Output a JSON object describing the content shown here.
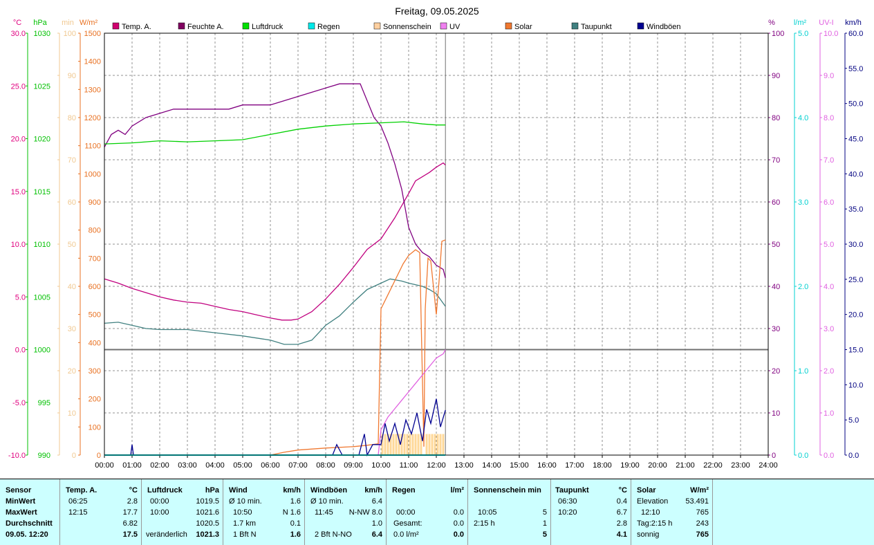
{
  "chart_data": {
    "type": "line",
    "title": "Freitag, 09.05.2025",
    "x_ticks": [
      "00:00",
      "01:00",
      "02:00",
      "03:00",
      "04:00",
      "05:00",
      "06:00",
      "07:00",
      "08:00",
      "09:00",
      "10:00",
      "11:00",
      "12:00",
      "13:00",
      "14:00",
      "15:00",
      "16:00",
      "17:00",
      "18:00",
      "19:00",
      "20:00",
      "21:00",
      "22:00",
      "23:00",
      "24:00"
    ],
    "x_range_hours": [
      0,
      24
    ],
    "current_time_hours": 12.33,
    "grid": true,
    "axes": {
      "temp": {
        "unit": "°C",
        "range": [
          -10,
          30
        ],
        "ticks": [
          "-10.0",
          "-5.0",
          "0.0",
          "5.0",
          "10.0",
          "15.0",
          "20.0",
          "25.0",
          "30.0"
        ],
        "color": "#e0007f"
      },
      "pressure": {
        "unit": "hPa",
        "range": [
          990,
          1030
        ],
        "ticks": [
          "990",
          "995",
          "1000",
          "1005",
          "1010",
          "1015",
          "1020",
          "1025",
          "1030"
        ],
        "color": "#00c000"
      },
      "sun_min": {
        "unit": "min",
        "range": [
          0,
          100
        ],
        "ticks": [
          "0",
          "10",
          "20",
          "30",
          "40",
          "50",
          "60",
          "70",
          "80",
          "90",
          "100"
        ],
        "color": "#f0c890"
      },
      "solar": {
        "unit": "W/m²",
        "range": [
          0,
          1500
        ],
        "ticks": [
          "0",
          "100",
          "200",
          "300",
          "400",
          "500",
          "600",
          "700",
          "800",
          "900",
          "1000",
          "1100",
          "1200",
          "1300",
          "1400",
          "1500"
        ],
        "color": "#e87020"
      },
      "humidity": {
        "unit": "%",
        "range": [
          0,
          100
        ],
        "ticks": [
          "0",
          "10",
          "20",
          "30",
          "40",
          "50",
          "60",
          "70",
          "80",
          "90",
          "100"
        ],
        "color": "#800080"
      },
      "rain": {
        "unit": "l/m²",
        "range": [
          0,
          5
        ],
        "ticks": [
          "0.0",
          "1.0",
          "2.0",
          "3.0",
          "4.0",
          "5.0"
        ],
        "color": "#00d0d0"
      },
      "uv": {
        "unit": "UV-I",
        "range": [
          0,
          10
        ],
        "ticks": [
          "0.0",
          "1.0",
          "2.0",
          "3.0",
          "4.0",
          "5.0",
          "6.0",
          "7.0",
          "8.0",
          "9.0",
          "10.0"
        ],
        "color": "#e060e0"
      },
      "wind": {
        "unit": "km/h",
        "range": [
          0,
          60
        ],
        "ticks": [
          "0.0",
          "5.0",
          "10.0",
          "15.0",
          "20.0",
          "25.0",
          "30.0",
          "35.0",
          "40.0",
          "45.0",
          "50.0",
          "55.0",
          "60.0"
        ],
        "color": "#000080"
      }
    },
    "legend": [
      {
        "name": "Temp. A.",
        "color": "#d0006f"
      },
      {
        "name": "Feuchte A.",
        "color": "#800060"
      },
      {
        "name": "Luftdruck",
        "color": "#00e000"
      },
      {
        "name": "Regen",
        "color": "#00e8e8"
      },
      {
        "name": "Sonnenschein",
        "color": "#ffd0a0"
      },
      {
        "name": "UV",
        "color": "#f080f0"
      },
      {
        "name": "Solar",
        "color": "#f07830"
      },
      {
        "name": "Taupunkt",
        "color": "#408080"
      },
      {
        "name": "Windböen",
        "color": "#000090"
      }
    ],
    "series": [
      {
        "name": "Temp. A.",
        "axis": "temp",
        "color": "#c0007f",
        "x": [
          0,
          0.5,
          1,
          1.5,
          2,
          2.5,
          3,
          3.5,
          4,
          4.5,
          5,
          5.5,
          6,
          6.42,
          6.75,
          7,
          7.5,
          8,
          8.5,
          9,
          9.5,
          10,
          10.5,
          11,
          11.25,
          11.5,
          11.75,
          12,
          12.25,
          12.33
        ],
        "y": [
          6.7,
          6.3,
          5.8,
          5.4,
          5.0,
          4.7,
          4.5,
          4.4,
          4.1,
          3.8,
          3.6,
          3.3,
          3.0,
          2.8,
          2.8,
          2.9,
          3.6,
          4.8,
          6.2,
          7.8,
          9.5,
          10.5,
          12.5,
          14.8,
          16.0,
          16.4,
          16.8,
          17.3,
          17.7,
          17.5
        ]
      },
      {
        "name": "Feuchte A.",
        "axis": "humidity",
        "color": "#800080",
        "x": [
          0,
          0.25,
          0.5,
          0.75,
          1,
          1.5,
          2,
          2.5,
          3,
          4,
          4.5,
          5,
          6,
          6.5,
          7,
          7.5,
          8,
          8.5,
          9,
          9.25,
          9.5,
          9.75,
          10,
          10.25,
          10.5,
          10.75,
          11,
          11.25,
          11.5,
          11.75,
          12,
          12.25,
          12.33
        ],
        "y": [
          73,
          76,
          77,
          76,
          78,
          80,
          81,
          82,
          82,
          82,
          82,
          83,
          83,
          84,
          85,
          86,
          87,
          88,
          88,
          88,
          84,
          80,
          78,
          74,
          69,
          63,
          54,
          50,
          48,
          47,
          45,
          44,
          42
        ]
      },
      {
        "name": "Luftdruck",
        "axis": "pressure",
        "color": "#00d000",
        "x": [
          0,
          1,
          2,
          3,
          4,
          5,
          6,
          7,
          8,
          9,
          10,
          10.83,
          11.5,
          12,
          12.33
        ],
        "y": [
          1019.5,
          1019.6,
          1019.8,
          1019.7,
          1019.8,
          1019.9,
          1020.4,
          1020.9,
          1021.2,
          1021.4,
          1021.5,
          1021.6,
          1021.4,
          1021.3,
          1021.3
        ]
      },
      {
        "name": "Taupunkt",
        "axis": "temp",
        "color": "#408080",
        "x": [
          0,
          0.5,
          1,
          1.5,
          2,
          3,
          4,
          5,
          6,
          6.5,
          7,
          7.5,
          8,
          8.5,
          9,
          9.5,
          10,
          10.33,
          10.75,
          11,
          11.5,
          11.75,
          12,
          12.33
        ],
        "y": [
          2.5,
          2.6,
          2.3,
          2.0,
          1.9,
          1.9,
          1.6,
          1.3,
          0.9,
          0.5,
          0.5,
          0.9,
          2.3,
          3.2,
          4.5,
          5.7,
          6.3,
          6.7,
          6.5,
          6.3,
          6.0,
          5.7,
          5.3,
          4.1
        ]
      },
      {
        "name": "Solar",
        "axis": "solar",
        "color": "#f07830",
        "x": [
          0,
          6,
          6.5,
          7,
          8,
          9,
          9.5,
          9.9,
          10.0,
          10.2,
          10.5,
          10.8,
          11,
          11.25,
          11.4,
          11.55,
          11.6,
          11.7,
          11.8,
          12.0,
          12.1,
          12.2,
          12.33
        ],
        "y": [
          0,
          0,
          10,
          18,
          25,
          30,
          35,
          40,
          520,
          560,
          620,
          680,
          710,
          730,
          720,
          30,
          520,
          700,
          690,
          500,
          620,
          760,
          765
        ]
      },
      {
        "name": "UV",
        "axis": "uv",
        "color": "#e060e0",
        "x": [
          0,
          9.9,
          10.0,
          10.25,
          10.5,
          10.75,
          11,
          11.25,
          11.5,
          11.75,
          12,
          12.25,
          12.33
        ],
        "y": [
          0,
          0,
          0.6,
          0.9,
          1.1,
          1.3,
          1.5,
          1.7,
          1.9,
          2.1,
          2.3,
          2.4,
          2.5
        ]
      },
      {
        "name": "Windböen",
        "axis": "wind",
        "color": "#000090",
        "x": [
          0,
          0.95,
          1,
          1.05,
          1.5,
          8.25,
          8.4,
          8.6,
          9.2,
          9.4,
          9.5,
          9.7,
          10,
          10.15,
          10.3,
          10.5,
          10.7,
          10.9,
          11.1,
          11.3,
          11.5,
          11.65,
          11.8,
          12.0,
          12.15,
          12.33
        ],
        "y": [
          0,
          0,
          1.5,
          0,
          0,
          0,
          1.5,
          0,
          0,
          3.0,
          0,
          1.5,
          1.5,
          4.5,
          2.0,
          4.5,
          1.5,
          5.0,
          3.0,
          6.0,
          2.0,
          6.5,
          4.5,
          8.0,
          4.0,
          6.4
        ]
      },
      {
        "name": "Regen",
        "axis": "rain",
        "color": "#00e8e8",
        "x": [
          0,
          12.33
        ],
        "y": [
          0,
          0
        ]
      }
    ],
    "sunshine_bars": {
      "axis": "sun_min",
      "color": "#ffd898",
      "x": [
        10.05,
        10.15,
        10.25,
        10.35,
        10.45,
        10.55,
        10.65,
        10.75,
        10.85,
        10.95,
        11.05,
        11.15,
        11.25,
        11.35,
        11.45,
        11.65,
        11.75,
        11.85,
        11.95,
        12.05,
        12.15,
        12.25
      ],
      "y": [
        5,
        5,
        5,
        5,
        5,
        5,
        5,
        5,
        5,
        5,
        5,
        5,
        5,
        5,
        5,
        5,
        5,
        5,
        5,
        5,
        5,
        5
      ]
    }
  },
  "stats": {
    "sensor": {
      "header": "Sensor",
      "rows": [
        "MinWert",
        "MaxWert",
        "Durchschnitt",
        "09.05. 12:20"
      ]
    },
    "temp": {
      "header": "Temp. A.",
      "unit": "°C",
      "rows": [
        [
          "06:25",
          "2.8"
        ],
        [
          "12:15",
          "17.7"
        ],
        [
          "",
          "6.82"
        ],
        [
          "",
          "17.5"
        ]
      ]
    },
    "pressure": {
      "header": "Luftdruck",
      "unit": "hPa",
      "rows": [
        [
          "00:00",
          "1019.5"
        ],
        [
          "10:00",
          "1021.6"
        ],
        [
          "",
          "1020.5"
        ],
        [
          "veränderlich",
          "1021.3"
        ]
      ]
    },
    "wind": {
      "header": "Wind",
      "unit": "km/h",
      "rows": [
        [
          "Ø 10 min.",
          "1.6"
        ],
        [
          "10:50",
          "N 1.6"
        ],
        [
          "1.7 km",
          "0.1"
        ],
        [
          "1 Bft N",
          "1.6"
        ]
      ]
    },
    "gusts": {
      "header": "Windböen",
      "unit": "km/h",
      "rows": [
        [
          "Ø 10 min.",
          "6.4"
        ],
        [
          "11:45",
          "N-NW 8.0"
        ],
        [
          "",
          "1.0"
        ],
        [
          "2 Bft N-NO",
          "6.4"
        ]
      ]
    },
    "rain": {
      "header": "Regen",
      "unit": "l/m²",
      "rows": [
        [
          "",
          ""
        ],
        [
          "00:00",
          "0.0"
        ],
        [
          "Gesamt:",
          "0.0"
        ],
        [
          "0.0 l/m²",
          "0.0"
        ]
      ]
    },
    "sunshine": {
      "header": "Sonnenschein min",
      "rows": [
        [
          "",
          ""
        ],
        [
          "10:05",
          "5"
        ],
        [
          "2:15 h",
          "1"
        ],
        [
          "",
          "5"
        ]
      ]
    },
    "dewpoint": {
      "header": "Taupunkt",
      "unit": "°C",
      "rows": [
        [
          "06:30",
          "0.4"
        ],
        [
          "10:20",
          "6.7"
        ],
        [
          "",
          "2.8"
        ],
        [
          "",
          "4.1"
        ]
      ]
    },
    "solar": {
      "header": "Solar",
      "unit": "W/m²",
      "rows": [
        [
          "Elevation",
          "53.491"
        ],
        [
          "12:10",
          "765"
        ],
        [
          "Tag:2:15 h",
          "243"
        ],
        [
          "sonnig",
          "765"
        ]
      ]
    }
  }
}
